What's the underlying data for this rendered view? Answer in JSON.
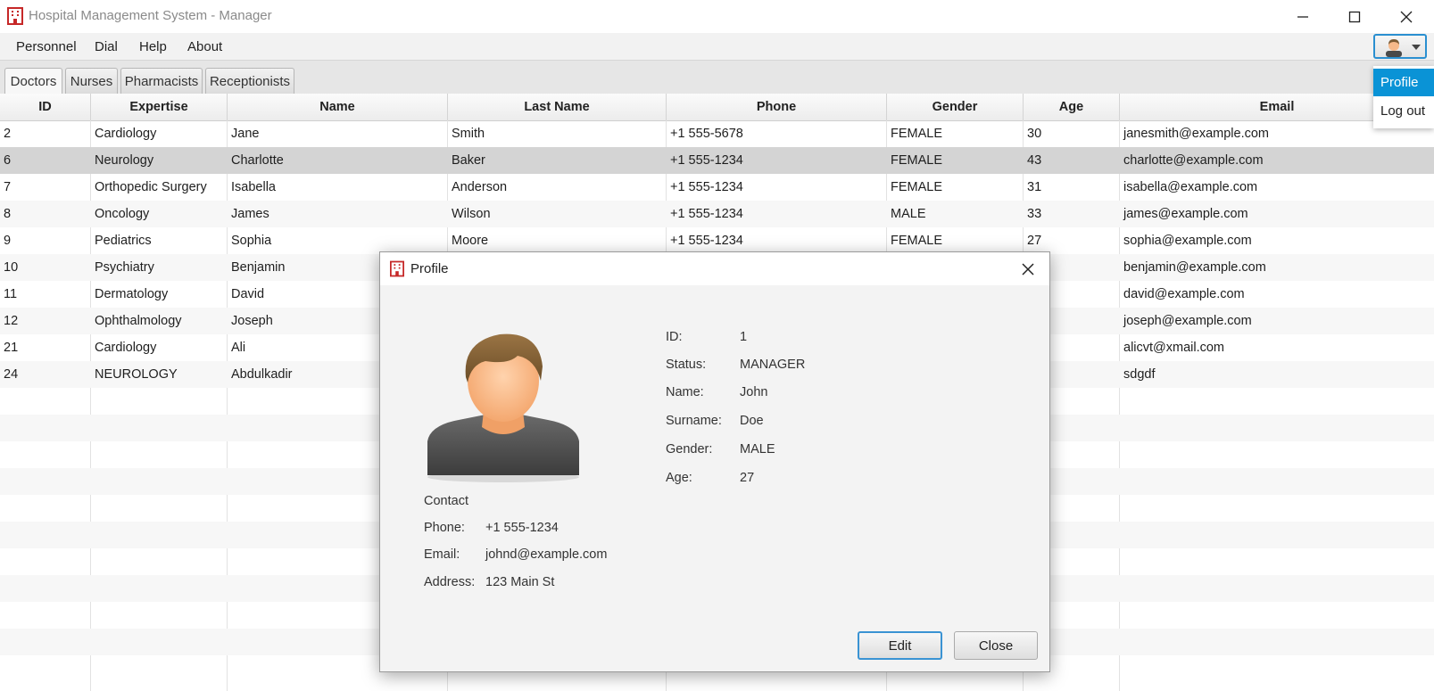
{
  "window": {
    "title": "Hospital Management System - Manager"
  },
  "menu": {
    "items": [
      "Personnel",
      "Dial",
      "Help",
      "About"
    ]
  },
  "tabs": [
    "Doctors",
    "Nurses",
    "Pharmacists",
    "Receptionists"
  ],
  "active_tab": "Doctors",
  "table": {
    "columns": [
      "ID",
      "Expertise",
      "Name",
      "Last Name",
      "Phone",
      "Gender",
      "Age",
      "Email"
    ],
    "rows": [
      [
        "2",
        "Cardiology",
        "Jane",
        "Smith",
        "+1 555-5678",
        "FEMALE",
        "30",
        "janesmith@example.com"
      ],
      [
        "6",
        "Neurology",
        "Charlotte",
        "Baker",
        "+1 555-1234",
        "FEMALE",
        "43",
        "charlotte@example.com"
      ],
      [
        "7",
        "Orthopedic Surgery",
        "Isabella",
        "Anderson",
        "+1 555-1234",
        "FEMALE",
        "31",
        "isabella@example.com"
      ],
      [
        "8",
        "Oncology",
        "James",
        "Wilson",
        "+1 555-1234",
        "MALE",
        "33",
        "james@example.com"
      ],
      [
        "9",
        "Pediatrics",
        "Sophia",
        "Moore",
        "+1 555-1234",
        "FEMALE",
        "27",
        "sophia@example.com"
      ],
      [
        "10",
        "Psychiatry",
        "Benjamin",
        "",
        "",
        "",
        "",
        "benjamin@example.com"
      ],
      [
        "11",
        "Dermatology",
        "David",
        "",
        "",
        "",
        "",
        "david@example.com"
      ],
      [
        "12",
        "Ophthalmology",
        "Joseph",
        "",
        "",
        "",
        "",
        "joseph@example.com"
      ],
      [
        "21",
        "Cardiology",
        "Ali",
        "",
        "",
        "",
        "",
        "alicvt@xmail.com"
      ],
      [
        "24",
        "NEUROLOGY",
        "Abdulkadir",
        "",
        "",
        "",
        "",
        "sdgdf"
      ]
    ],
    "selected_row": 1
  },
  "user_menu": {
    "items": [
      "Profile",
      "Log out"
    ],
    "highlighted": "Profile"
  },
  "dialog": {
    "title": "Profile",
    "fields": [
      {
        "label": "ID:",
        "value": "1"
      },
      {
        "label": "Status:",
        "value": "MANAGER"
      },
      {
        "label": "Name:",
        "value": "John"
      },
      {
        "label": "Surname:",
        "value": "Doe"
      },
      {
        "label": "Gender:",
        "value": "MALE"
      },
      {
        "label": "Age:",
        "value": "27"
      }
    ],
    "contact": {
      "heading": "Contact",
      "phone_label": "Phone:",
      "phone": "+1 555-1234",
      "email_label": "Email:",
      "email": "johnd@example.com",
      "address_label": "Address:",
      "address": "123 Main St"
    },
    "buttons": {
      "edit": "Edit",
      "close": "Close"
    }
  },
  "colors": {
    "accent": "#0a93d6",
    "selected_row": "#d4d4d4",
    "app_icon": "#c62828"
  },
  "icons": [
    "hospital-icon",
    "minimize-icon",
    "maximize-icon",
    "close-icon",
    "user-icon",
    "chevron-down-icon",
    "avatar"
  ]
}
